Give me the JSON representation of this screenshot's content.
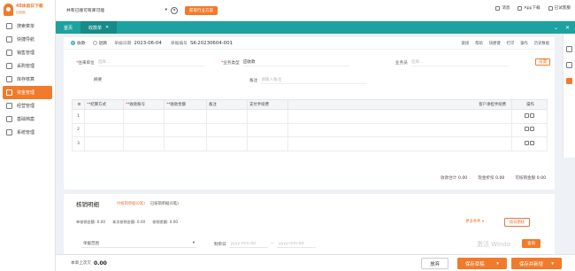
{
  "app": {
    "logo_title": "48体验日下载",
    "logo_sub": "比较版"
  },
  "sidebar": {
    "items": [
      {
        "label": "搜索菜单",
        "icon": "search-icon"
      },
      {
        "label": "快捷导航",
        "icon": "shortcut-icon"
      },
      {
        "label": "销售管理",
        "icon": "sales-icon"
      },
      {
        "label": "采购管理",
        "icon": "purchase-icon"
      },
      {
        "label": "库存核算",
        "icon": "inventory-icon"
      },
      {
        "label": "资金管理",
        "icon": "fund-icon"
      },
      {
        "label": "经营管理",
        "icon": "business-icon"
      },
      {
        "label": "基础档案",
        "icon": "archive-icon"
      },
      {
        "label": "系统管理",
        "icon": "system-icon"
      }
    ]
  },
  "topbar": {
    "company": "共有已顺可有库可能",
    "solution_btn": "获取行业方案",
    "messages": "消息",
    "app_download": "App下载",
    "user": "已试客服"
  },
  "tabs": [
    {
      "label": "首页"
    },
    {
      "label": "收款单"
    }
  ],
  "form": {
    "radio_receive": "收款",
    "radio_refund": "退款",
    "date_label": "单据日期",
    "date_value": "2023-06-04",
    "doc_label": "单据编号",
    "doc_value": "SK-20230604-001",
    "tools": [
      "链接",
      "帮助",
      "快捷键",
      "打印",
      "操作",
      "历史数据"
    ],
    "customer_label": "往来单位",
    "customer_placeholder": "选择...",
    "biztype_label": "业务类型",
    "biztype_value": "应收款",
    "staff_label": "业务员",
    "staff_placeholder": "选择...",
    "settings_label": "设置",
    "sort_label": "摘要",
    "remark_label": "备注",
    "remark_placeholder": "请输入备注"
  },
  "table": {
    "headers": [
      "",
      "*结算方式",
      "*收款账号",
      "*收款金额",
      "备注",
      "支付手续费",
      "客户承担手续费",
      "操作"
    ],
    "rows": [
      "1",
      "2",
      "3"
    ]
  },
  "summary": {
    "total_label": "收款合计",
    "total_value": "0.00",
    "fee_label": "现金折扣",
    "fee_value": "0.00",
    "write_label": "可核销金额",
    "write_value": "0.00"
  },
  "writeoff": {
    "title": "核销明细",
    "tab1": "付核销单据(0笔)",
    "tab2": "已核销单据(0笔)",
    "stats": [
      "单核销金额: 0.00",
      "本次核销金额: 0.00",
      "核销差额: 0.00"
    ],
    "more": "更多条件",
    "btn": "按日期核",
    "range_label": "单据范围",
    "date_label": "制单日",
    "date_placeholder1": "yyyy-mm-dd",
    "date_placeholder2": "yyyy-mm-dd",
    "query": "查询"
  },
  "watermark": "激活 Windo",
  "footer": {
    "balance_label": "本单上次欠",
    "balance_value": "0.00",
    "cancel": "放弃",
    "save": "保存草稿",
    "save_new": "保存并新增"
  }
}
